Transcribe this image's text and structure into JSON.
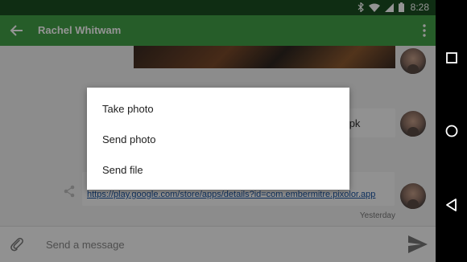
{
  "status_bar": {
    "time": "8:28"
  },
  "app_bar": {
    "title": "Rachel Whitwam"
  },
  "messages": {
    "file_name": "king.apk",
    "link": "https://play.google.com/store/apps/details?id=com.embermitre.pixolor.app",
    "timestamp": "Yesterday"
  },
  "composer": {
    "placeholder": "Send a message"
  },
  "attach_menu": {
    "items": [
      "Take photo",
      "Send photo",
      "Send file"
    ]
  },
  "colors": {
    "app_bar": "#43a047",
    "status_bar": "#1a4e22",
    "link": "#1a55a3"
  }
}
